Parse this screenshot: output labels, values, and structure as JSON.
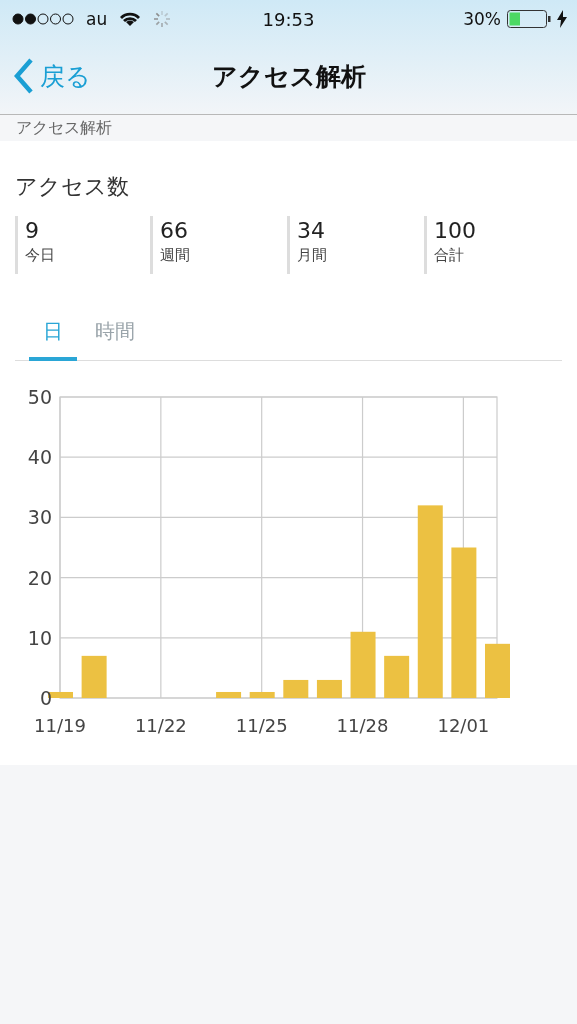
{
  "status_bar": {
    "carrier": "au",
    "time": "19:53",
    "battery_text": "30%",
    "battery": {
      "level": 0.3
    }
  },
  "nav": {
    "back": "戻る",
    "title": "アクセス解析"
  },
  "scrolled_heading": "アクセス解析",
  "section_title": "アクセス数",
  "stats": [
    {
      "value": "9",
      "label": "今日"
    },
    {
      "value": "66",
      "label": "週間"
    },
    {
      "value": "34",
      "label": "月間"
    },
    {
      "value": "100",
      "label": "合計"
    }
  ],
  "tabs": [
    {
      "label": "日",
      "selected": true
    },
    {
      "label": "時間",
      "selected": false
    }
  ],
  "chart": {
    "chart_data": {
      "type": "bar",
      "categories": [
        "11/19",
        null,
        null,
        "11/22",
        null,
        null,
        "11/25",
        null,
        null,
        "11/28",
        null,
        null,
        "12/01",
        null
      ],
      "series": [
        {
          "color": "#ecc142",
          "values": [
            1,
            7,
            0,
            0,
            0,
            1,
            1,
            3,
            3,
            11,
            7,
            32,
            25,
            9
          ]
        }
      ],
      "ylim": [
        0,
        50
      ],
      "grid": true,
      "yticks": [
        0,
        10,
        20,
        30,
        40,
        50
      ]
    }
  }
}
